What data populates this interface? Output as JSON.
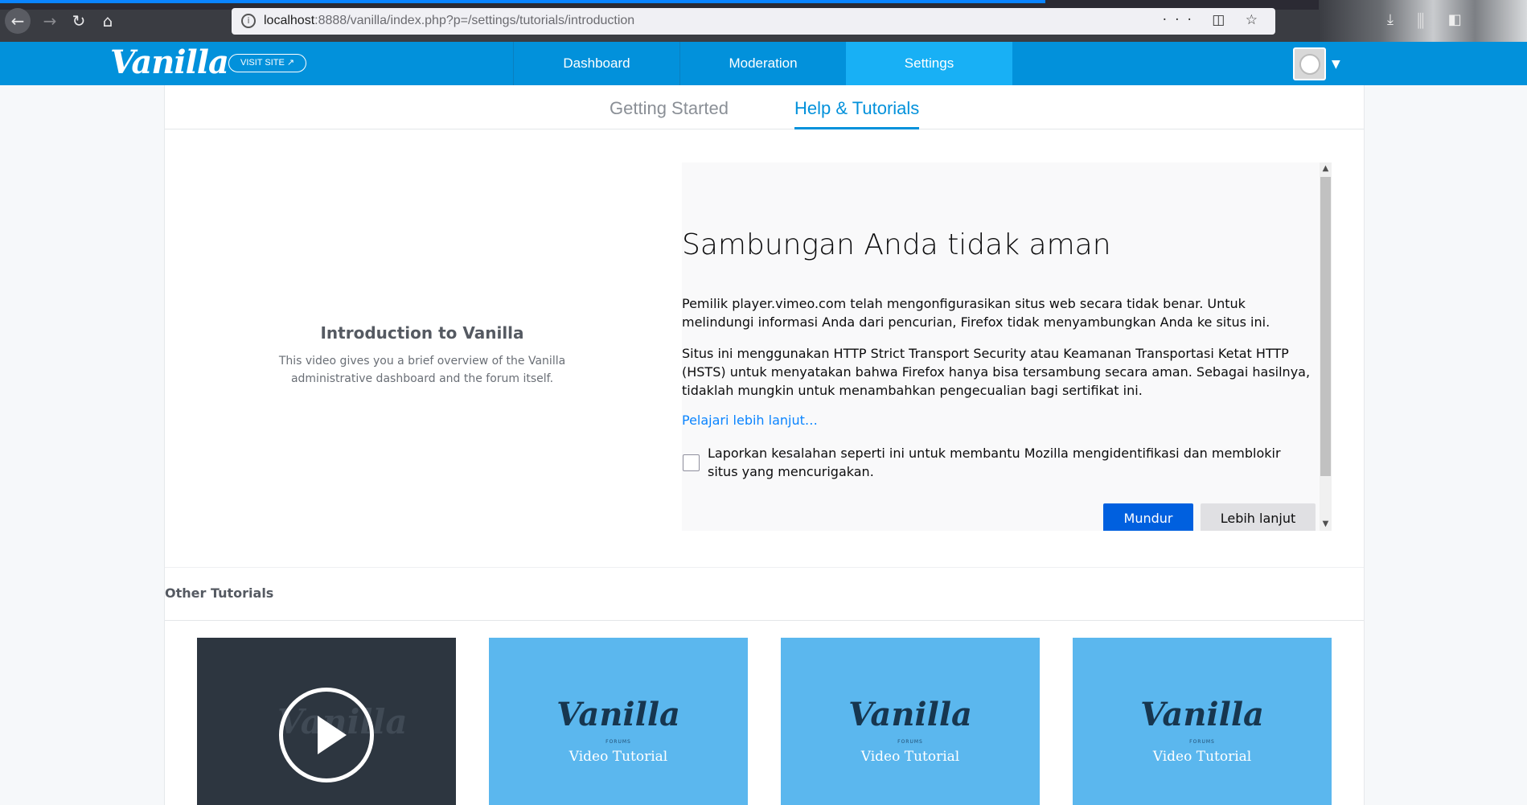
{
  "browser": {
    "url_host": "localhost",
    "url_rest": ":8888/vanilla/index.php?p=/settings/tutorials/introduction",
    "url_actions": "··· ◫ ☆",
    "toolbar_icons": "⤓ ⫼ ◧"
  },
  "header": {
    "logo": "Vanilla",
    "visit_site": "VISIT SITE ↗",
    "nav": [
      "Dashboard",
      "Moderation",
      "Settings"
    ],
    "active_nav": "Settings",
    "accent": "#0291db"
  },
  "subtabs": [
    "Getting Started",
    "Help & Tutorials"
  ],
  "intro": {
    "title": "Introduction to Vanilla",
    "description": "This video gives you a brief overview of the Vanilla administrative dashboard and the forum itself."
  },
  "error_frame": {
    "title": "Sambungan Anda tidak aman",
    "p1": "Pemilik player.vimeo.com telah mengonfigurasikan situs web secara tidak benar. Untuk melindungi informasi Anda dari pencurian, Firefox tidak menyambungkan Anda ke situs ini.",
    "p2": "Situs ini menggunakan HTTP Strict Transport Security atau Keamanan Transportasi Ketat HTTP (HSTS) untuk menyatakan bahwa Firefox hanya bisa tersambung secara aman. Sebagai hasilnya, tidaklah mungkin untuk menambahkan pengecualian bagi sertifikat ini.",
    "learn_more": "Pelajari lebih lanjut…",
    "report_label": "Laporkan kesalahan seperti ini untuk membantu Mozilla mengidentifikasi dan memblokir situs yang mencurigakan.",
    "back_button": "Mundur",
    "advanced_button": "Lebih lanjut"
  },
  "other_tutorials": {
    "title": "Other Tutorials",
    "cards": [
      {
        "type": "video-dark",
        "ghost_text": "Vanilla"
      },
      {
        "type": "thumb",
        "logo": "Vanilla",
        "forums": "FORUMS",
        "caption": "Video Tutorial"
      },
      {
        "type": "thumb",
        "logo": "Vanilla",
        "forums": "FORUMS",
        "caption": "Video Tutorial"
      },
      {
        "type": "thumb",
        "logo": "Vanilla",
        "forums": "FORUMS",
        "caption": "Video Tutorial"
      }
    ]
  }
}
